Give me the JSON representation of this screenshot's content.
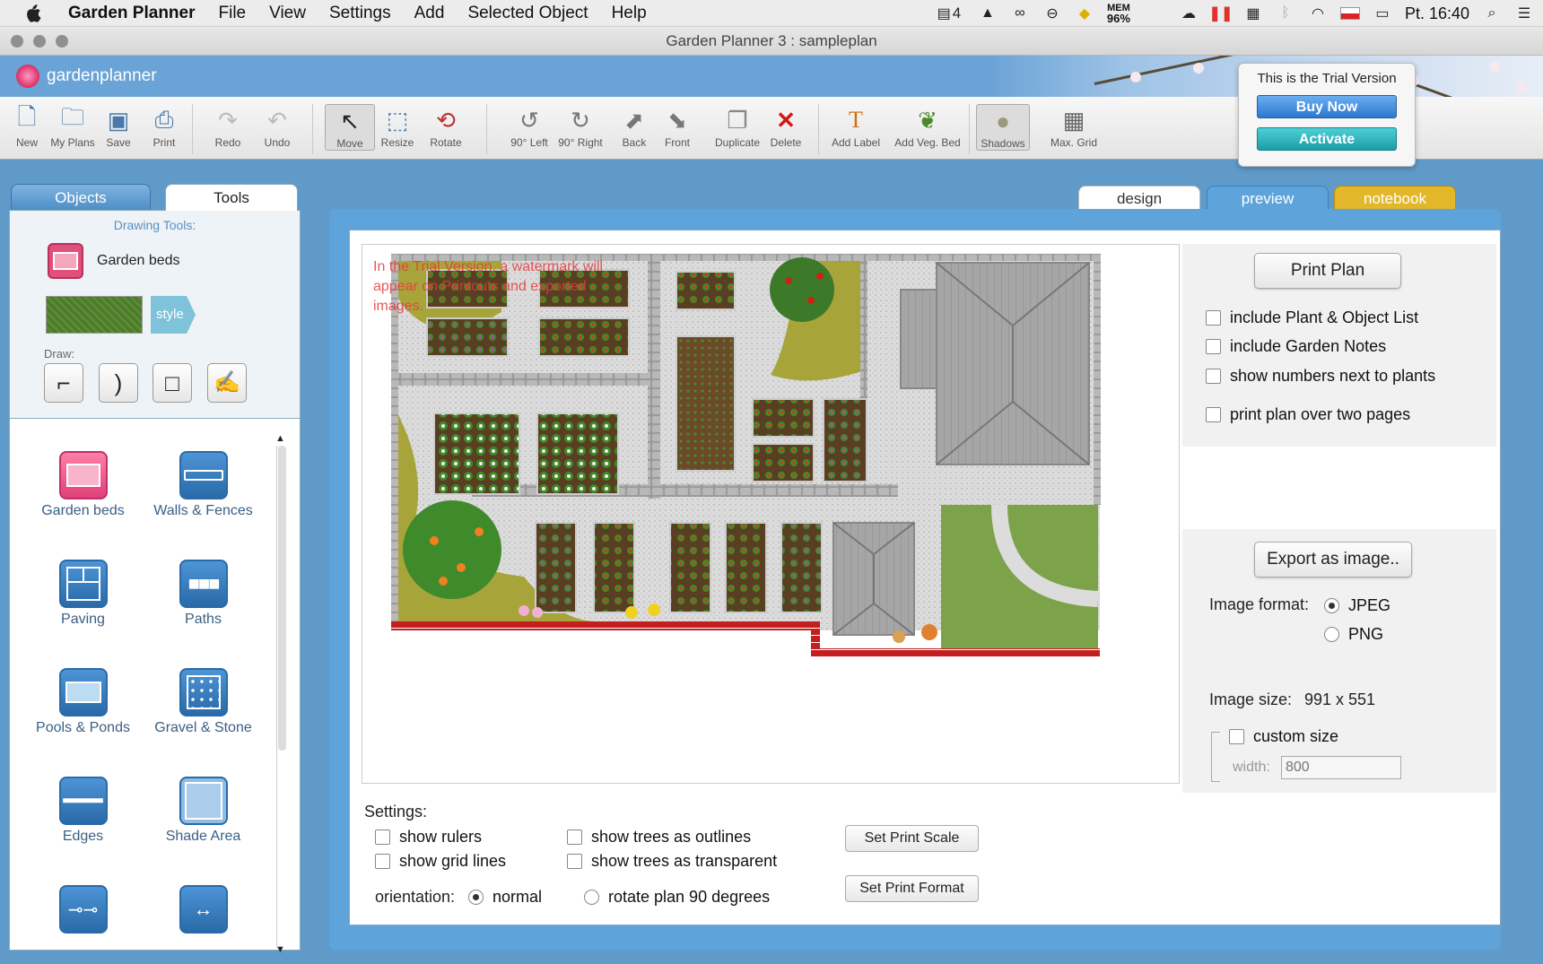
{
  "menubar": {
    "app": "Garden Planner",
    "items": [
      "File",
      "View",
      "Settings",
      "Add",
      "Selected Object",
      "Help"
    ],
    "status": {
      "notif_count": "4",
      "mem_label": "MEM",
      "mem_value": "96%",
      "clock": "Pt. 16:40"
    }
  },
  "window": {
    "title": "Garden Planner 3 : sampleplan"
  },
  "brand": {
    "logo_text": "gardenplanner"
  },
  "toolbar": {
    "buttons": [
      {
        "label": "New",
        "icon": "new-document-icon",
        "enabled": true
      },
      {
        "label": "My Plans",
        "icon": "folder-icon",
        "enabled": true
      },
      {
        "label": "Save",
        "icon": "save-icon",
        "enabled": true
      },
      {
        "label": "Print",
        "icon": "print-icon",
        "enabled": true
      },
      {
        "label": "Redo",
        "icon": "redo-icon",
        "enabled": false
      },
      {
        "label": "Undo",
        "icon": "undo-icon",
        "enabled": false
      },
      {
        "label": "Move",
        "icon": "cursor-icon",
        "enabled": true
      },
      {
        "label": "Resize",
        "icon": "resize-icon",
        "enabled": true
      },
      {
        "label": "Rotate",
        "icon": "rotate-icon",
        "enabled": true
      },
      {
        "label": "90° Left",
        "icon": "rotate-left-icon",
        "enabled": true
      },
      {
        "label": "90° Right",
        "icon": "rotate-right-icon",
        "enabled": true
      },
      {
        "label": "Back",
        "icon": "send-back-icon",
        "enabled": true
      },
      {
        "label": "Front",
        "icon": "bring-front-icon",
        "enabled": true
      },
      {
        "label": "Duplicate",
        "icon": "duplicate-icon",
        "enabled": true
      },
      {
        "label": "Delete",
        "icon": "delete-icon",
        "enabled": true
      },
      {
        "label": "Add Label",
        "icon": "text-label-icon",
        "enabled": true
      },
      {
        "label": "Add Veg. Bed",
        "icon": "veg-bed-icon",
        "enabled": true
      },
      {
        "label": "Shadows",
        "icon": "shadows-icon",
        "enabled": true
      },
      {
        "label": "Max. Grid",
        "icon": "grid-icon",
        "enabled": true
      }
    ]
  },
  "trial": {
    "title": "This is the Trial Version",
    "buy_label": "Buy Now",
    "activate_label": "Activate"
  },
  "left_panel": {
    "tabs": [
      {
        "label": "Objects",
        "active": false
      },
      {
        "label": "Tools",
        "active": true
      }
    ],
    "drawing_tools_header": "Drawing Tools:",
    "current_tool": "Garden beds",
    "style_label": "style",
    "draw_label": "Draw:",
    "objects": [
      {
        "label": "Garden beds",
        "icon": "garden-bed-icon"
      },
      {
        "label": "Walls & Fences",
        "icon": "walls-fences-icon"
      },
      {
        "label": "Paving",
        "icon": "paving-icon"
      },
      {
        "label": "Paths",
        "icon": "paths-icon"
      },
      {
        "label": "Pools & Ponds",
        "icon": "pools-ponds-icon"
      },
      {
        "label": "Gravel & Stone",
        "icon": "gravel-stone-icon"
      },
      {
        "label": "Edges",
        "icon": "edges-icon"
      },
      {
        "label": "Shade Area",
        "icon": "shade-area-icon"
      }
    ]
  },
  "view_tabs": [
    {
      "label": "design",
      "color": "#ffffff"
    },
    {
      "label": "preview",
      "color": "#5ea4da"
    },
    {
      "label": "notebook",
      "color": "#e2b82a"
    }
  ],
  "preview": {
    "watermark": "In the Trial Version, a watermark will appear on Printouts and exported images.",
    "print_plan_label": "Print Plan",
    "print_options": [
      {
        "label": "include Plant & Object List",
        "checked": false
      },
      {
        "label": "include Garden Notes",
        "checked": false
      },
      {
        "label": "show numbers next to plants",
        "checked": false
      },
      {
        "label": "print plan over two pages",
        "checked": false
      }
    ],
    "export_label": "Export as image..",
    "image_format_label": "Image format:",
    "formats": [
      {
        "label": "JPEG",
        "selected": true
      },
      {
        "label": "PNG",
        "selected": false
      }
    ],
    "image_size_label": "Image size:",
    "image_size_value": "991 x 551",
    "custom_size_label": "custom size",
    "width_label": "width:",
    "width_placeholder": "800",
    "settings_label": "Settings:",
    "settings": [
      {
        "label": "show rulers",
        "checked": false
      },
      {
        "label": "show grid lines",
        "checked": false
      },
      {
        "label": "show trees as outlines",
        "checked": false
      },
      {
        "label": "show trees as transparent",
        "checked": false
      }
    ],
    "orientation_label": "orientation:",
    "orientation_options": [
      {
        "label": "normal",
        "selected": true
      },
      {
        "label": "rotate plan 90 degrees",
        "selected": false
      }
    ],
    "set_print_scale_label": "Set Print Scale",
    "set_print_format_label": "Set Print Format"
  }
}
